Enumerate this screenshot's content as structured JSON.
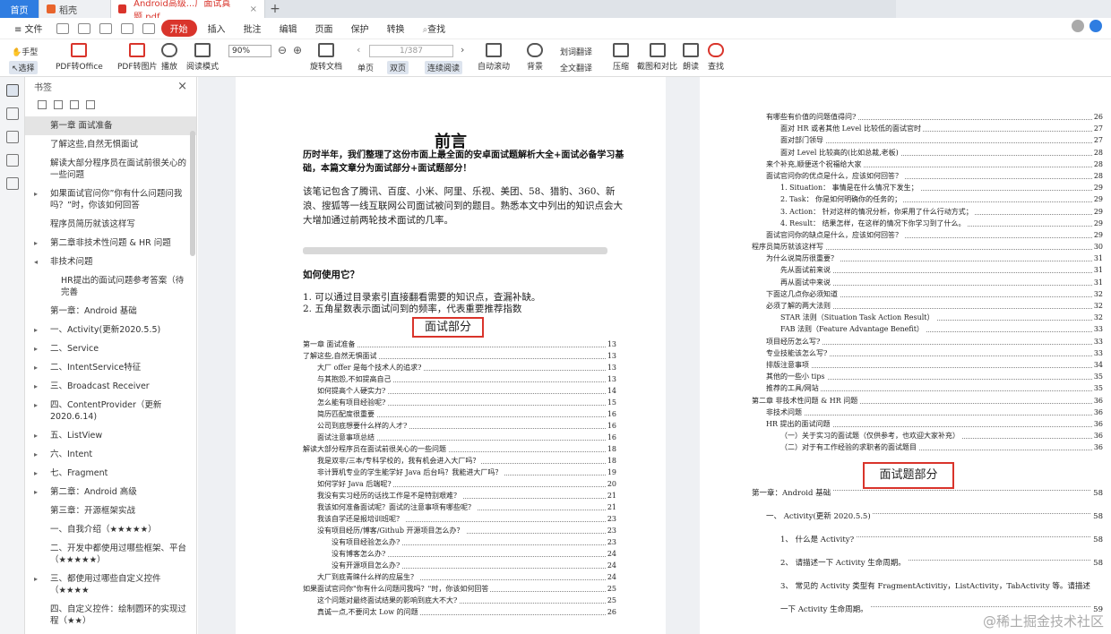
{
  "tabs": {
    "home": "首页",
    "draft": "稻壳",
    "doc": "Android高级...厂面试真题.pdf",
    "new": "+"
  },
  "menu": {
    "file": "≡ 文件",
    "items": [
      "开始",
      "插入",
      "批注",
      "编辑",
      "页面",
      "保护",
      "转换"
    ],
    "search": "查找"
  },
  "toolbar": {
    "hand": "手型",
    "select": "选择",
    "pdf_office": "PDF转Office",
    "pdf_image": "PDF转图片",
    "play": "播放",
    "read_mode": "阅读模式",
    "zoom": "90%",
    "rotate": "旋转文档",
    "page_input": "1/387",
    "single": "单页",
    "double": "双页",
    "continuous": "连续阅读",
    "auto_scroll": "自动滚动",
    "background": "背景",
    "translate_select": "划词翻译",
    "translate_full": "全文翻译",
    "compress": "压缩",
    "screenshot": "截图和对比",
    "read_aloud": "朗读",
    "find": "查找"
  },
  "bookmarks": {
    "title": "书签",
    "items": [
      {
        "label": "第一章 面试准备",
        "arrow": "",
        "sub": false
      },
      {
        "label": "了解这些,自然无惧面试",
        "arrow": "",
        "sub": false
      },
      {
        "label": "解读大部分程序员在面试前很关心的一些问题",
        "arrow": "",
        "sub": false
      },
      {
        "label": "如果面试官问你”你有什么问题问我吗？”时，你该如何回答",
        "arrow": "▸",
        "sub": false
      },
      {
        "label": "程序员简历就该这样写",
        "arrow": "",
        "sub": false
      },
      {
        "label": "第二章非技术性问题 & HR 问题",
        "arrow": "▸",
        "sub": false
      },
      {
        "label": "非技术问题",
        "arrow": "◂",
        "sub": false
      },
      {
        "label": "HR提出的面试问题参考答案（待完善",
        "arrow": "",
        "sub": true
      },
      {
        "label": "第一章：Android 基础",
        "arrow": "",
        "sub": false
      },
      {
        "label": "一、Activity(更新2020.5.5)",
        "arrow": "▸",
        "sub": false
      },
      {
        "label": "二、Service",
        "arrow": "▸",
        "sub": false
      },
      {
        "label": "二、IntentService特征",
        "arrow": "▸",
        "sub": false
      },
      {
        "label": "三、Broadcast Receiver",
        "arrow": "▸",
        "sub": false
      },
      {
        "label": "四、ContentProvider（更新2020.6.14)",
        "arrow": "▸",
        "sub": false
      },
      {
        "label": "五、ListView",
        "arrow": "▸",
        "sub": false
      },
      {
        "label": "六、Intent",
        "arrow": "▸",
        "sub": false
      },
      {
        "label": "七、Fragment",
        "arrow": "▸",
        "sub": false
      },
      {
        "label": "第二章：Android 高级",
        "arrow": "▸",
        "sub": false
      },
      {
        "label": "第三章：开源框架实战",
        "arrow": "",
        "sub": false
      },
      {
        "label": "一、自我介绍（★★★★★）",
        "arrow": "",
        "sub": false
      },
      {
        "label": "二、开发中都使用过哪些框架、平台（★★★★★）",
        "arrow": "",
        "sub": false
      },
      {
        "label": "三、都使用过哪些自定义控件（★★★★",
        "arrow": "▸",
        "sub": false
      },
      {
        "label": "四、自定义控件：绘制圆环的实现过程（★★）",
        "arrow": "",
        "sub": false
      }
    ]
  },
  "page1": {
    "title": "前言",
    "bold_intro": "历时半年，我们整理了这份市面上最全面的安卓面试题解析大全+面试必备学习基础，本篇文章分为面试部分+面试题部分！",
    "para1": "该笔记包含了腾讯、百度、小米、阿里、乐视、美团、58、猎豹、360、新浪、搜狐等一线互联网公司面试被问到的题目。熟悉本文中列出的知识点会大大增加通过前两轮技术面试的几率。",
    "how_title": "如何使用它？",
    "how1": "1. 可以通过目录索引直接翻看需要的知识点，查漏补缺。",
    "how2": "2. 五角星数表示面试问到的频率，代表重要推荐指数",
    "section_label": "面试部分",
    "toc": [
      {
        "t": "第一章  面试准备",
        "n": "13",
        "i": 0
      },
      {
        "t": "了解这些,自然无惧面试",
        "n": "13",
        "i": 0
      },
      {
        "t": "大厂 offer 是每个技术人的追求?",
        "n": "13",
        "i": 1
      },
      {
        "t": "与其抱怨,不如提高自己",
        "n": "13",
        "i": 1
      },
      {
        "t": "如何提高个人硬实力?",
        "n": "14",
        "i": 1
      },
      {
        "t": "怎么能有项目经验呢?",
        "n": "15",
        "i": 1
      },
      {
        "t": "简历匹配度很重要",
        "n": "16",
        "i": 1
      },
      {
        "t": "公司到底想要什么样的人才?",
        "n": "16",
        "i": 1
      },
      {
        "t": "面试注意事项总结",
        "n": "16",
        "i": 1
      },
      {
        "t": "解读大部分程序员在面试前很关心的一些问题",
        "n": "18",
        "i": 0
      },
      {
        "t": "我是双非/三本/专科学校的，我有机会进入大厂吗？",
        "n": "18",
        "i": 1
      },
      {
        "t": "非计算机专业的学生能学好 Java 后台吗？我能进大厂吗？",
        "n": "19",
        "i": 1
      },
      {
        "t": "如何学好 Java 后端呢?",
        "n": "20",
        "i": 1
      },
      {
        "t": "我没有实习经历的话找工作是不是特别艰难？",
        "n": "21",
        "i": 1
      },
      {
        "t": "我该如何准备面试呢？面试的注意事项有哪些呢？",
        "n": "21",
        "i": 1
      },
      {
        "t": "我该自学还是报培训班呢？",
        "n": "23",
        "i": 1
      },
      {
        "t": "没有项目经历/博客/Github 开源项目怎么办？",
        "n": "23",
        "i": 1
      },
      {
        "t": "没有项目经验怎么办?",
        "n": "23",
        "i": 2
      },
      {
        "t": "没有博客怎么办?",
        "n": "24",
        "i": 2
      },
      {
        "t": "没有开源项目怎么办?",
        "n": "24",
        "i": 2
      },
      {
        "t": "大厂到底青睐什么样的应届生？",
        "n": "24",
        "i": 1
      },
      {
        "t": "如果面试官问你\"你有什么问题问我吗？\"时，你该如何回答",
        "n": "25",
        "i": 0
      },
      {
        "t": "这个问题对最终面试结果的影响到底大不大?",
        "n": "25",
        "i": 1
      },
      {
        "t": "真诚一点,不要问太 Low 的问题",
        "n": "26",
        "i": 1
      }
    ]
  },
  "page2": {
    "toc": [
      {
        "t": "有哪些有价值的问题值得问?",
        "n": "26",
        "i": 1
      },
      {
        "t": "面对 HR 或者其他 Level 比较低的面试官时",
        "n": "27",
        "i": 2
      },
      {
        "t": "面对部门领导",
        "n": "27",
        "i": 2
      },
      {
        "t": "面对 Level 比较高的(比如总裁,老板)",
        "n": "28",
        "i": 2
      },
      {
        "t": "来个补充,顺便送个祝福给大家",
        "n": "28",
        "i": 1
      },
      {
        "t": "面试官问你的优点是什么，应该如何回答？",
        "n": "28",
        "i": 1
      },
      {
        "t": "1. Situation：   事情是在什么情况下发生；",
        "n": "29",
        "i": 2
      },
      {
        "t": "2. Task：    你是如何明确你的任务的；",
        "n": "29",
        "i": 2
      },
      {
        "t": "3. Action：   针对这样的情况分析，你采用了什么行动方式；",
        "n": "29",
        "i": 2
      },
      {
        "t": "4. Result：   结果怎样，在这样的情况下你学习到了什么。",
        "n": "29",
        "i": 2
      },
      {
        "t": "面试官问你的缺点是什么，应该如何回答？",
        "n": "29",
        "i": 1
      },
      {
        "t": "程序员简历就该这样写",
        "n": "30",
        "i": 0
      },
      {
        "t": "为什么说简历很重要？",
        "n": "31",
        "i": 1
      },
      {
        "t": "先从面试前来说",
        "n": "31",
        "i": 2
      },
      {
        "t": "再从面试中来说",
        "n": "31",
        "i": 2
      },
      {
        "t": "下面这几点你必须知道",
        "n": "32",
        "i": 1
      },
      {
        "t": "必须了解的两大法则",
        "n": "32",
        "i": 1
      },
      {
        "t": "STAR 法则（Situation Task Action Result）",
        "n": "32",
        "i": 2
      },
      {
        "t": "FAB  法则（Feature Advantage Benefit）",
        "n": "33",
        "i": 2
      },
      {
        "t": "项目经历怎么写?",
        "n": "33",
        "i": 1
      },
      {
        "t": "专业技能该怎么写?",
        "n": "33",
        "i": 1
      },
      {
        "t": "排版注意事项",
        "n": "34",
        "i": 1
      },
      {
        "t": "其他的一些小 tips",
        "n": "35",
        "i": 1
      },
      {
        "t": "推荐的工具/网站",
        "n": "35",
        "i": 1
      },
      {
        "t": "第二章  非技术性问题  &  HR  问题",
        "n": "36",
        "i": 0
      },
      {
        "t": "非技术问题",
        "n": "36",
        "i": 1
      },
      {
        "t": "HR 提出的面试问题",
        "n": "36",
        "i": 1
      },
      {
        "t": "（一）关于实习的面试题（仅供参考，也欢迎大家补充）",
        "n": "36",
        "i": 2
      },
      {
        "t": "（二）对于有工作经验的求职者的面试题目",
        "n": "36",
        "i": 2
      }
    ],
    "section_label": "面试题部分",
    "toc_big": [
      {
        "t": "第一章：Android  基础",
        "n": "58",
        "i": 0
      },
      {
        "t": "一、   Activity(更新 2020.5.5)",
        "n": "58",
        "i": 1
      },
      {
        "t": "1、  什么是 Activity?",
        "n": "58",
        "i": 2
      },
      {
        "t": "2、  请描述一下 Activity 生命周期。",
        "n": "58",
        "i": 2
      },
      {
        "t": "3、  常见的 Activity 类型有 FragmentActivitiy，ListActivity，TabActivity 等。请描述",
        "n": "",
        "i": 2
      },
      {
        "t": "一下 Activity 生命周期。",
        "n": "59",
        "i": 2
      }
    ]
  },
  "watermark": "@稀土掘金技术社区"
}
